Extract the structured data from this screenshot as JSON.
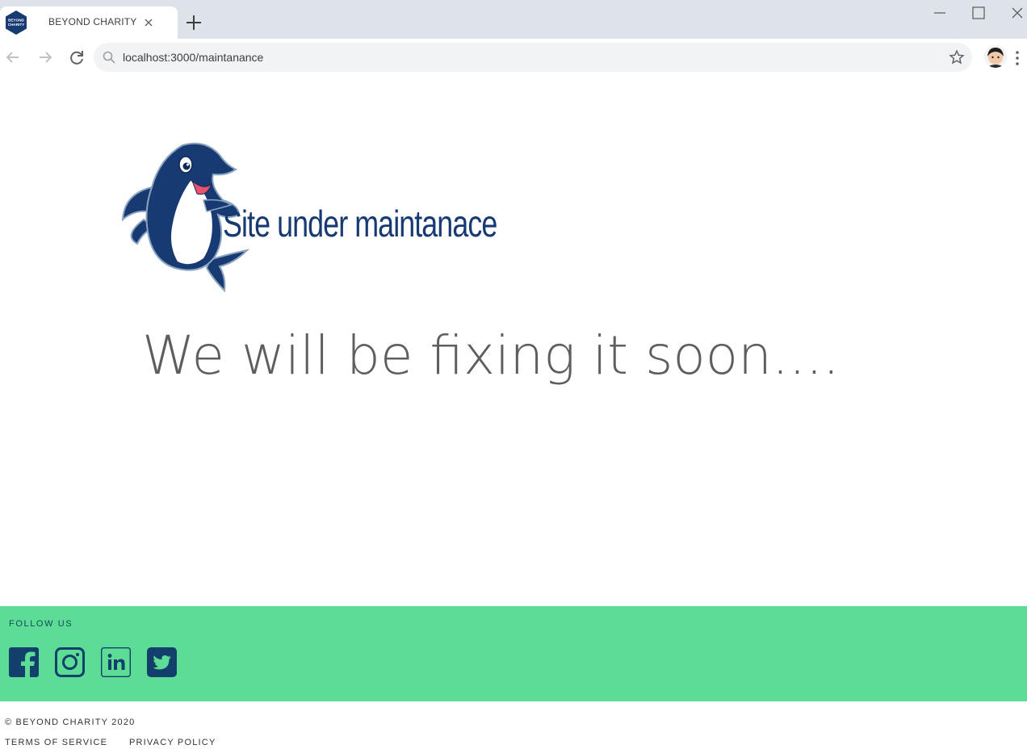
{
  "browser": {
    "tab": {
      "title": "BEYOND CHARITY",
      "favicon_icon": "beyond-charity-logo-icon",
      "favicon_text_line1": "BEYOND",
      "favicon_text_line2": "CHARITY"
    },
    "url": "localhost:3000/maintanance",
    "icons": [
      "back-arrow-icon",
      "forward-arrow-icon",
      "reload-icon",
      "search-icon",
      "star-icon",
      "profile-avatar",
      "kebab-menu-icon",
      "close-icon",
      "new-tab-plus-icon",
      "minimize-icon",
      "maximize-icon"
    ]
  },
  "page": {
    "mascot_icon": "dolphin-mascot",
    "title": "Site under maintanace",
    "message": "We will be fixing it soon...."
  },
  "footer": {
    "follow_label": "FOLLOW US",
    "social": [
      {
        "name": "facebook",
        "icon": "facebook-icon"
      },
      {
        "name": "instagram",
        "icon": "instagram-icon"
      },
      {
        "name": "linkedin",
        "icon": "linkedin-icon"
      },
      {
        "name": "twitter",
        "icon": "twitter-icon"
      }
    ],
    "copyright": "© BEYOND CHARITY 2020",
    "links": {
      "terms": "TERMS OF SERVICE",
      "privacy": "PRIVACY POLICY"
    }
  },
  "colors": {
    "brand_navy": "#173a73",
    "footer_green": "#5ddc95",
    "social_icon": "#123f6b",
    "message_gray": "#5e5e5e"
  }
}
